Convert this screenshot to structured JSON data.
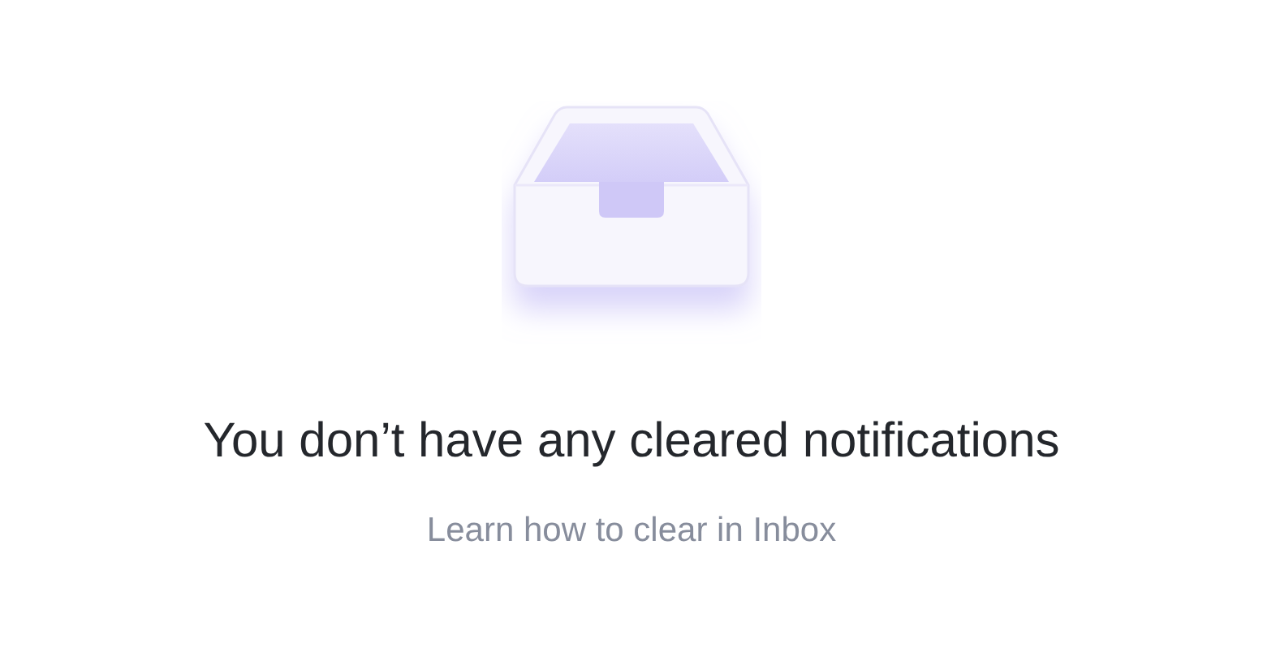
{
  "empty_state": {
    "title": "You don’t have any cleared notifications",
    "link": "Learn how to clear in Inbox"
  }
}
